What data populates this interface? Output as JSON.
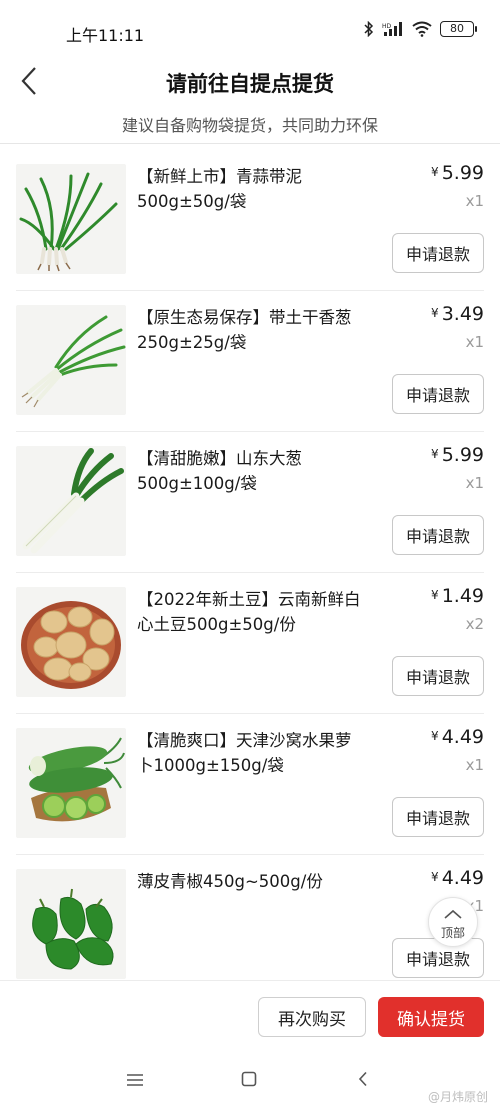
{
  "status_bar": {
    "time": "上午11:11",
    "battery": "80",
    "icons": [
      "bluetooth-icon",
      "cellular-signal-icon",
      "wifi-icon",
      "battery-icon"
    ]
  },
  "header": {
    "back_icon": "chevron-left-icon",
    "title": "请前往自提点提货",
    "subtitle": "建议自备购物袋提货，共同助力环保"
  },
  "items": [
    {
      "title": "【新鲜上市】青蒜带泥500g±50g/袋",
      "currency": "¥",
      "price": "5.99",
      "qty": "x1",
      "refund_label": "申请退款",
      "image": "green-garlic"
    },
    {
      "title": "【原生态易保存】带土干香葱250g±25g/袋",
      "currency": "¥",
      "price": "3.49",
      "qty": "x1",
      "refund_label": "申请退款",
      "image": "scallion"
    },
    {
      "title": "【清甜脆嫩】山东大葱500g±100g/袋",
      "currency": "¥",
      "price": "5.99",
      "qty": "x1",
      "refund_label": "申请退款",
      "image": "leek"
    },
    {
      "title": "【2022年新土豆】云南新鲜白心土豆500g±50g/份",
      "currency": "¥",
      "price": "1.49",
      "qty": "x2",
      "refund_label": "申请退款",
      "image": "potatoes"
    },
    {
      "title": "【清脆爽口】天津沙窝水果萝卜1000g±150g/袋",
      "currency": "¥",
      "price": "4.49",
      "qty": "x1",
      "refund_label": "申请退款",
      "image": "green-radish"
    },
    {
      "title": "薄皮青椒450g~500g/份",
      "currency": "¥",
      "price": "4.49",
      "qty": "x1",
      "refund_label": "申请退款",
      "image": "green-pepper"
    }
  ],
  "back_to_top": {
    "label": "顶部",
    "icon": "chevron-up-icon"
  },
  "actions": {
    "rebuy_label": "再次购买",
    "confirm_label": "确认提货"
  },
  "colors": {
    "primary_red": "#e1302c",
    "muted": "#9a9a9a",
    "border": "#c8c8c8"
  },
  "nav_bar": {
    "icons": [
      "menu-icon",
      "home-icon",
      "back-icon"
    ]
  },
  "watermark": "@月炜原创"
}
